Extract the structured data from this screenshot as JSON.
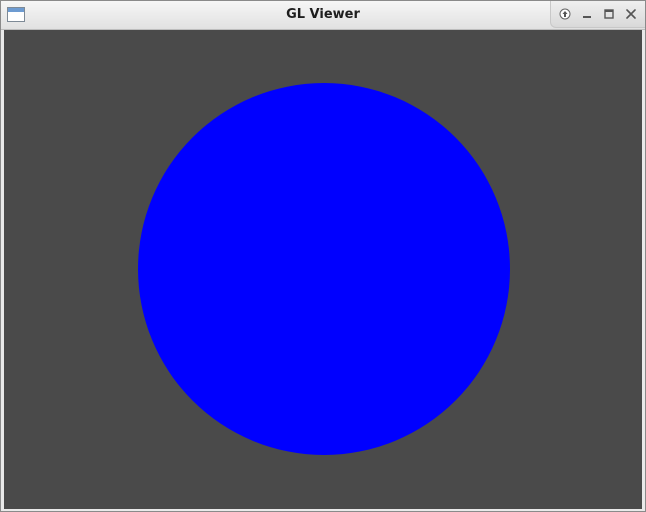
{
  "window": {
    "title": "GL Viewer",
    "icon": "window-app-icon",
    "controls": [
      {
        "name": "shade-button",
        "icon": "arrow-up-circle-icon"
      },
      {
        "name": "minimize-button",
        "icon": "minimize-icon"
      },
      {
        "name": "maximize-button",
        "icon": "maximize-icon"
      },
      {
        "name": "close-button",
        "icon": "close-icon"
      }
    ]
  },
  "viewport": {
    "background_color": "#4a4a4a",
    "shape": "circle",
    "shape_color": "#0000ff"
  }
}
